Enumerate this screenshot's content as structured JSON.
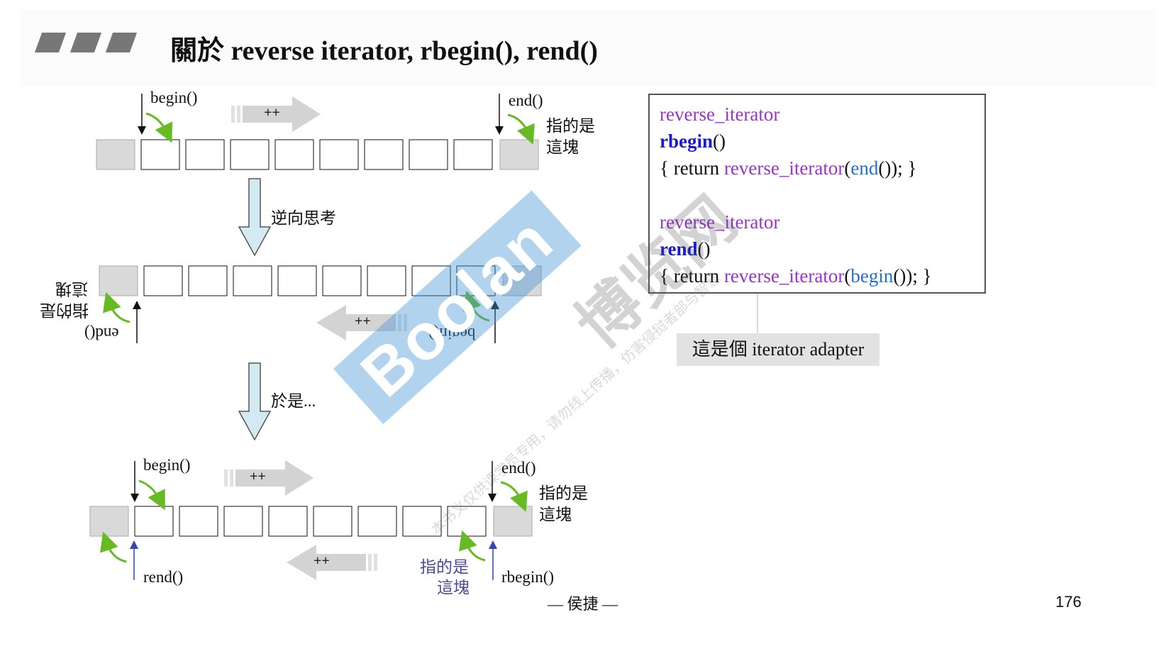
{
  "title": "關於 reverse iterator, rbegin(), rend()",
  "diagram": {
    "top": {
      "begin_label": "begin()",
      "end_label": "end()",
      "inc_label": "++",
      "points_to_line1": "指的是",
      "points_to_line2": "這塊"
    },
    "think_reverse": "逆向思考",
    "middle": {
      "end_label": "end()",
      "begin_label": "begin()",
      "inc_label": "++",
      "points_to_line1": "指的是",
      "points_to_line2": "這塊"
    },
    "therefore": "於是...",
    "bottom": {
      "begin_label": "begin()",
      "end_label": "end()",
      "rend_label": "rend()",
      "rbegin_label": "rbegin()",
      "inc_label_top": "++",
      "inc_label_bottom": "++",
      "points_to_end_line1": "指的是",
      "points_to_end_line2": "這塊",
      "points_to_rbegin_line1": "指的是",
      "points_to_rbegin_line2": "這塊"
    }
  },
  "code": {
    "l1": "reverse_iterator",
    "l2_name": "rbegin",
    "l2_paren": "()",
    "l3_a": "{ return ",
    "l3_b": "reverse_iterator",
    "l3_c": "(",
    "l3_d": "end",
    "l3_e": "()); }",
    "l4": "reverse_iterator",
    "l5_name": "rend",
    "l5_paren": "()",
    "l6_a": "{ return ",
    "l6_b": "reverse_iterator",
    "l6_c": "(",
    "l6_d": "begin",
    "l6_e": "()); }"
  },
  "adapter_note": "這是個 iterator adapter",
  "author": "— 侯捷 —",
  "page_number": "176",
  "watermark": {
    "brand": "Boolan",
    "zh": "博览网",
    "fine_print": "本书义仅供课学员专用，请勿线上传播，仿害侵挝者部与智慧"
  }
}
